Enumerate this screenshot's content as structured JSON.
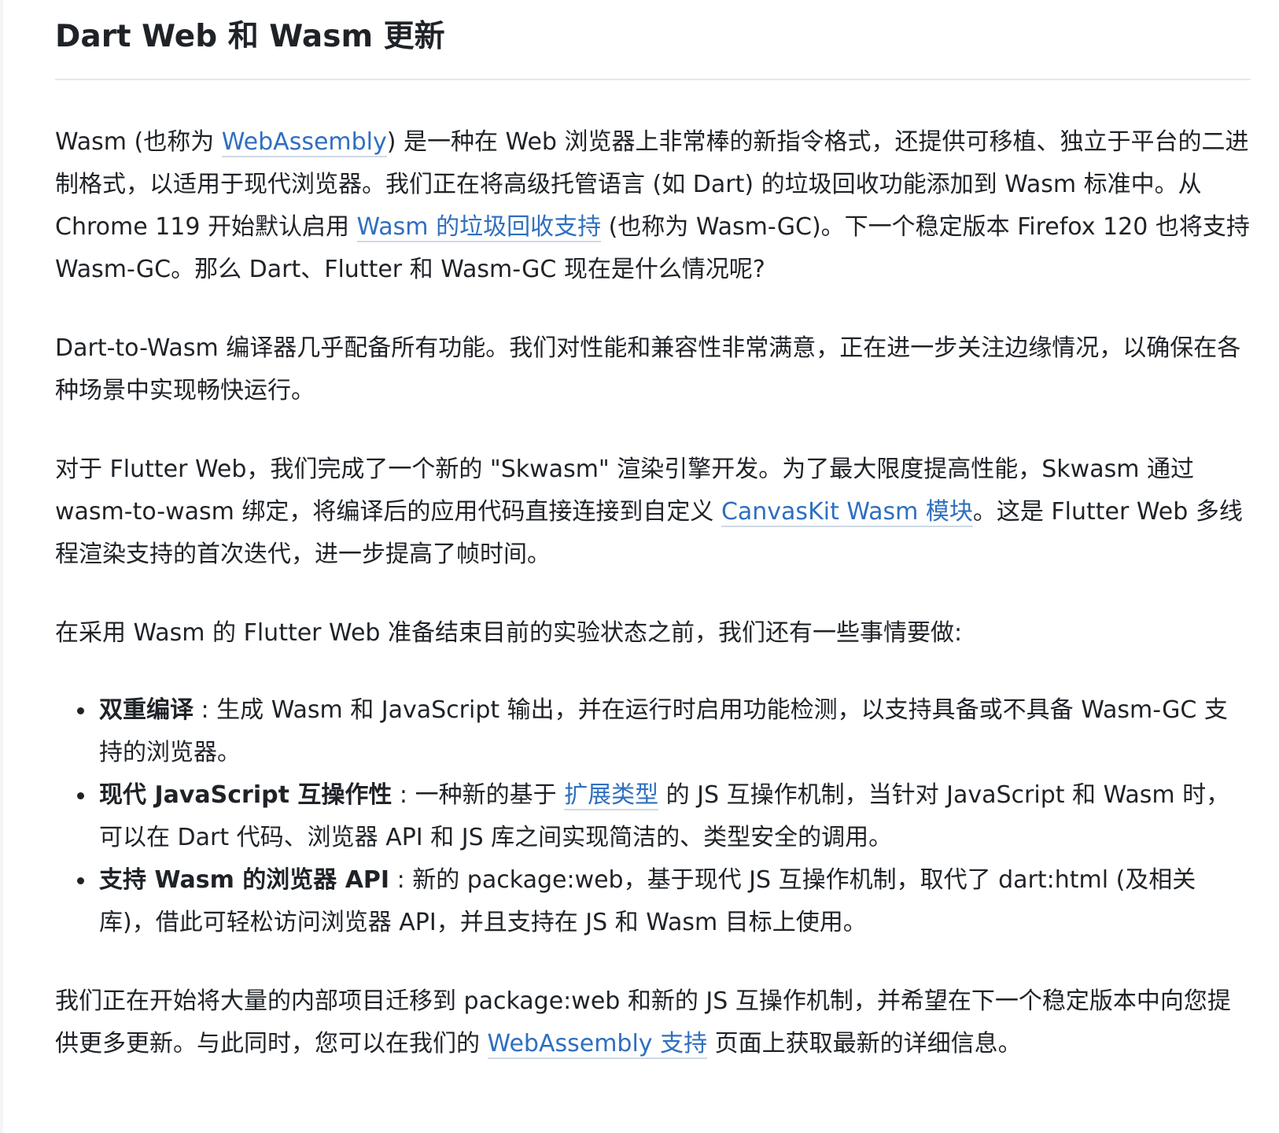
{
  "title": "Dart Web 和 Wasm 更新",
  "p1": {
    "t1": "Wasm (也称为 ",
    "link1": "WebAssembly",
    "t2": ") 是一种在 Web 浏览器上非常棒的新指令格式，还提供可移植、独立于平台的二进制格式，以适用于现代浏览器。我们正在将高级托管语言 (如 Dart) 的垃圾回收功能添加到 Wasm 标准中。从 Chrome 119 开始默认启用 ",
    "link2": "Wasm 的垃圾回收支持",
    "t3": " (也称为 Wasm-GC)。下一个稳定版本 Firefox 120 也将支持 Wasm-GC。那么 Dart、Flutter 和 Wasm-GC 现在是什么情况呢?"
  },
  "p2": "Dart-to-Wasm 编译器几乎配备所有功能。我们对性能和兼容性非常满意，正在进一步关注边缘情况，以确保在各种场景中实现畅快运行。",
  "p3": {
    "t1": "对于 Flutter Web，我们完成了一个新的 \"Skwasm\" 渲染引擎开发。为了最大限度提高性能，Skwasm 通过 wasm-to-wasm 绑定，将编译后的应用代码直接连接到自定义 ",
    "link1": "CanvasKit Wasm 模块",
    "t2": "。这是 Flutter Web 多线程渲染支持的首次迭代，进一步提高了帧时间。"
  },
  "p4": "在采用 Wasm 的 Flutter Web 准备结束目前的实验状态之前，我们还有一些事情要做:",
  "list": [
    {
      "bold": "双重编译",
      "t1": " : 生成 Wasm 和 JavaScript 输出，并在运行时启用功能检测，以支持具备或不具备 Wasm-GC 支持的浏览器。"
    },
    {
      "bold": "现代 JavaScript 互操作性",
      "t1": " : 一种新的基于 ",
      "link1": "扩展类型",
      "t2": " 的 JS 互操作机制，当针对 JavaScript 和 Wasm 时，可以在 Dart 代码、浏览器 API 和 JS 库之间实现简洁的、类型安全的调用。"
    },
    {
      "bold": "支持 Wasm 的浏览器 API",
      "t1": " : 新的 package:web，基于现代 JS 互操作机制，取代了 dart:html (及相关库)，借此可轻松访问浏览器 API，并且支持在 JS 和 Wasm 目标上使用。"
    }
  ],
  "p5": {
    "t1": "我们正在开始将大量的内部项目迁移到 package:web 和新的 JS 互操作机制，并希望在下一个稳定版本中向您提供更多更新。与此同时，您可以在我们的 ",
    "link1": "WebAssembly 支持",
    "t2": " 页面上获取最新的详细信息。"
  },
  "colors": {
    "text": "#1f2328",
    "link": "#2f6fbf",
    "divider": "#e6e8eb"
  }
}
